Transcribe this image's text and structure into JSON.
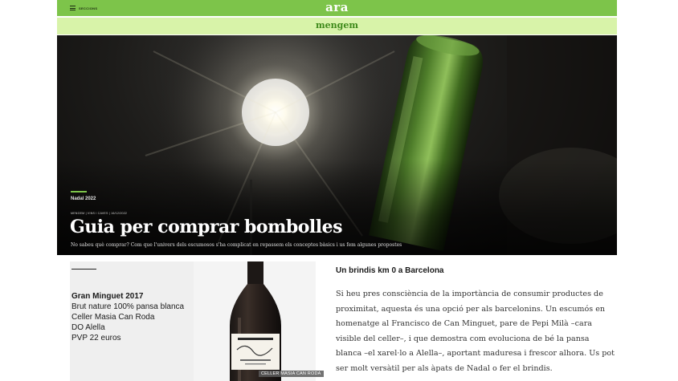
{
  "topbar": {
    "menu_label": "Seccions",
    "logo": "ara",
    "accent": "#7dc44a"
  },
  "section": {
    "name": "mengem",
    "background": "#d8f3a9"
  },
  "hero": {
    "tag": "Nadal 2022",
    "breadcrumbs": "Mengem | Vins i caves | 16/12/2022",
    "headline": "Guia per comprar bombolles",
    "subtitle": "No sabeu què comprar? Com que l'univers dels escumosos s'ha complicat en repassem els conceptes bàsics i us fem algunes propostes"
  },
  "wine_card": {
    "name": "Gran Minguet 2017",
    "type": "Brut nature 100% pansa blanca",
    "winery": "Celler Masia Can Roda",
    "denomination": "DO Alella",
    "price": "PVP 22 euros",
    "photo_credit": "Celler Masia Can Roda"
  },
  "article": {
    "heading": "Un brindis km 0 a Barcelona",
    "body_lines": [
      "Si heu pres consciència de la importància de consumir productes de",
      "proximitat, aquesta és una opció per als barcelonins. Un escumós en",
      "homenatge al Francisco de Can Minguet, pare de Pepi Milà –cara",
      "visible del celler–, i que demostra com evoluciona de bé la pansa",
      "blanca –el xarel·lo a Alella–, aportant maduresa i frescor alhora. Us pot",
      "ser molt versàtil per als àpats de Nadal o fer el brindis."
    ]
  }
}
